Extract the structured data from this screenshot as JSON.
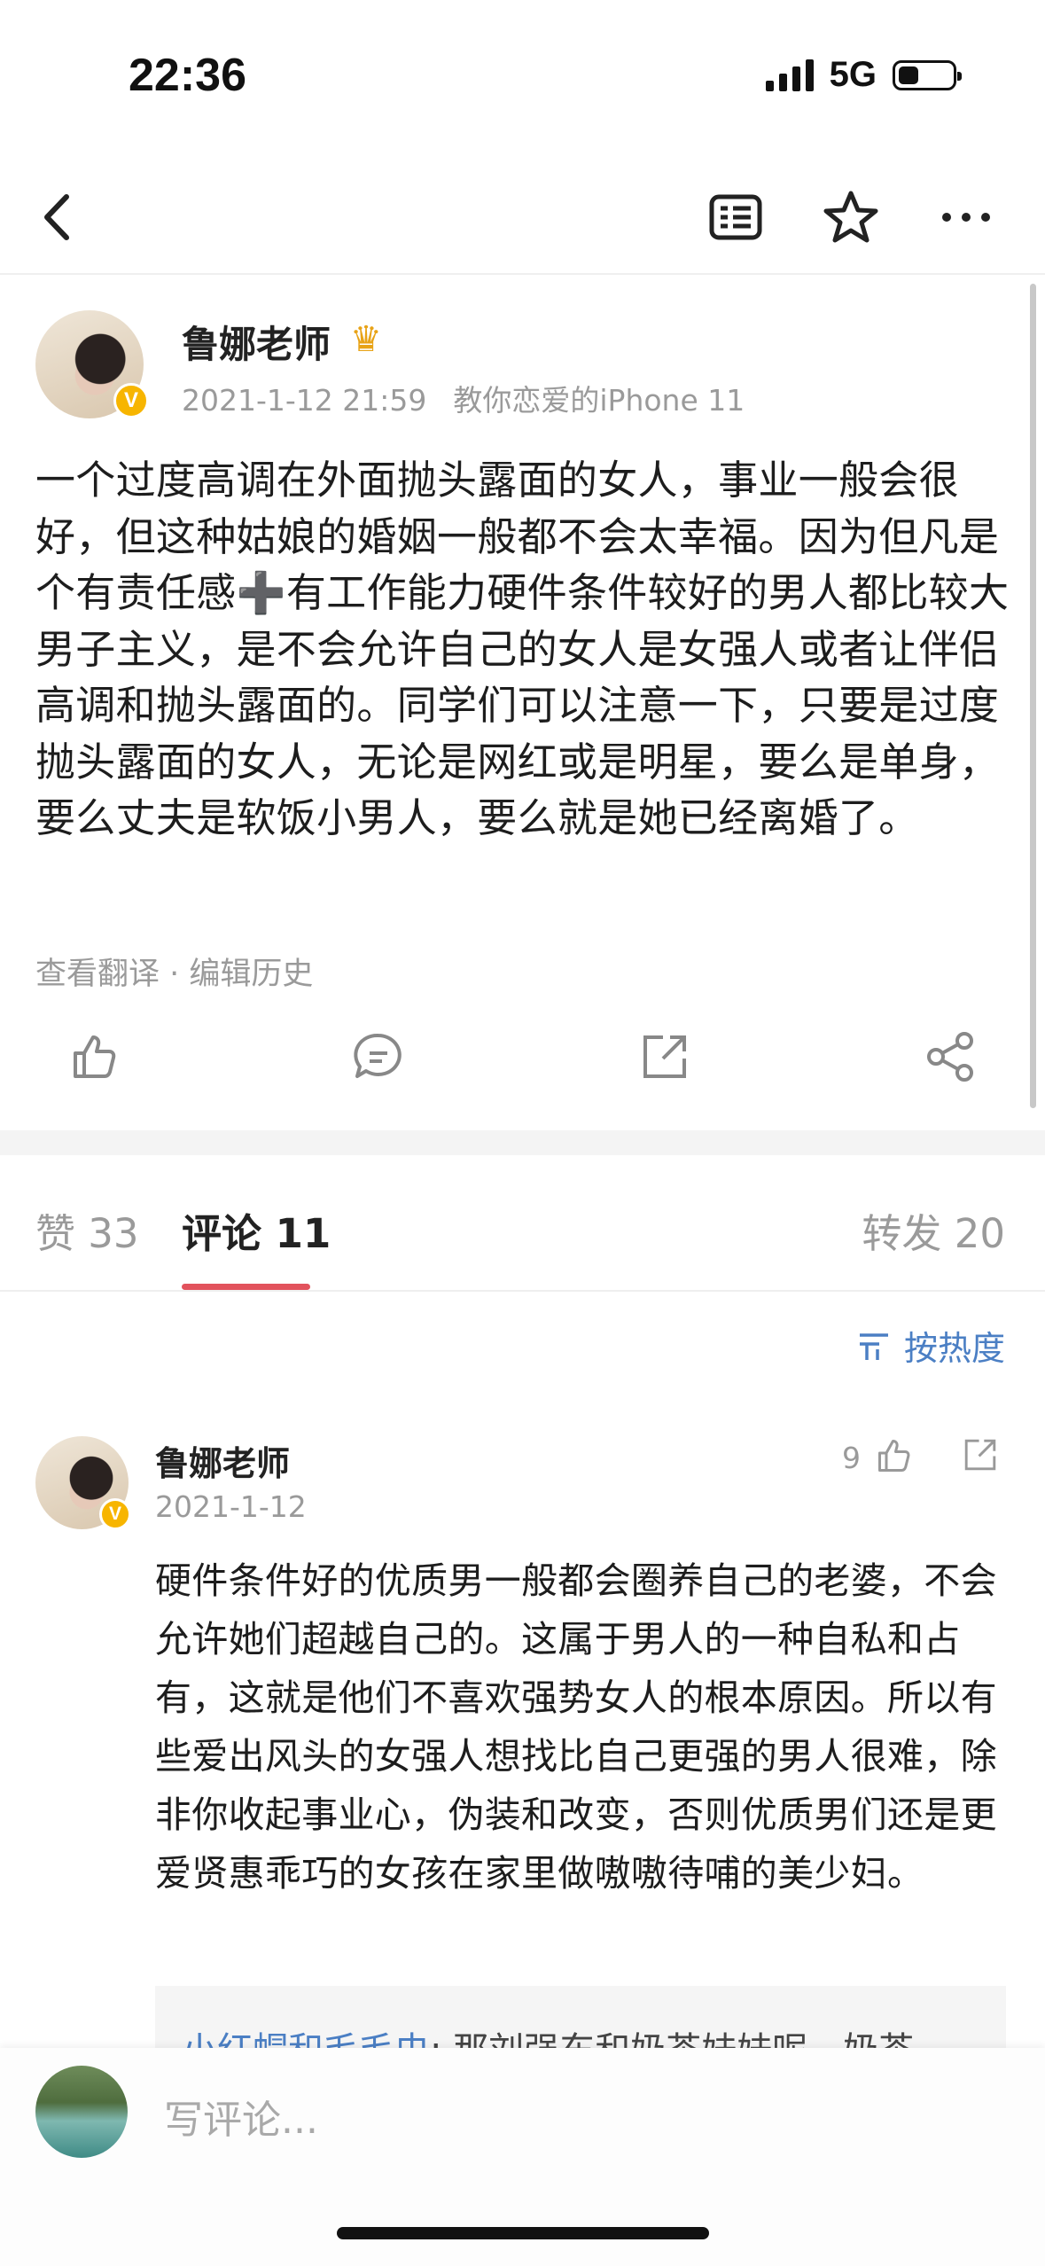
{
  "status_bar": {
    "time": "22:36",
    "network": "5G"
  },
  "post": {
    "author": "鲁娜老师",
    "verified_badge": "V",
    "crown_icon": "crown-icon",
    "date": "2021-1-12 21:59",
    "source": "教你恋爱的iPhone 11",
    "text_before_plus": "一个过度高调在外面抛头露面的女人，事业一般会很好，但这种姑娘的婚姻一般都不会太幸福。因为但凡是个有责任感",
    "plus_symbol": "➕",
    "text_after_plus": "有工作能力硬件条件较好的男人都比较大男子主义，是不会允许自己的女人是女强人或者让伴侣高调和抛头露面的。同学们可以注意一下，只要是过度抛头露面的女人，无论是网红或是明星，要么是单身，要么丈夫是软饭小男人，要么就是她已经离婚了。",
    "links": "查看翻译 · 编辑历史"
  },
  "tabs": {
    "like": "赞 33",
    "comment": "评论 11",
    "repost": "转发 20"
  },
  "sort_label": "按热度",
  "comment": {
    "author": "鲁娜老师",
    "date": "2021-1-12",
    "likes": "9",
    "text": "硬件条件好的优质男一般都会圈养自己的老婆，不会允许她们超越自己的。这属于男人的一种自私和占有，这就是他们不喜欢强势女人的根本原因。所以有些爱出风头的女强人想找比自己更强的男人很难，除非你收起事业心，伪装和改变，否则优质男们还是更爱贤惠乖巧的女孩在家里做嗷嗷待哺的美少妇。",
    "reply_user": "小红帽和毛毛虫",
    "reply_text": ": 那刘强东和奶茶妹妹呢，奶茶"
  },
  "input": {
    "placeholder": "写评论..."
  },
  "colors": {
    "accent": "#e2525c",
    "link": "#4b7fc4",
    "badge": "#f7b500"
  }
}
